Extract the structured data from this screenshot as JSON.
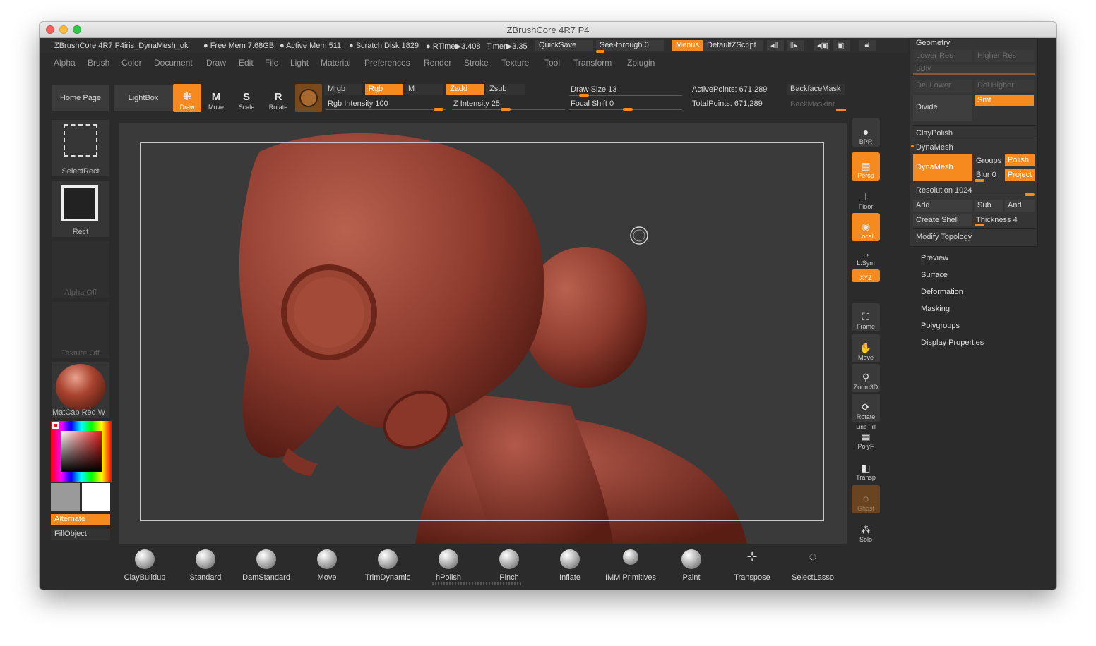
{
  "window": {
    "title": "ZBrushCore 4R7 P4"
  },
  "status": {
    "doc": "ZBrushCore 4R7 P4iris_DynaMesh_ok",
    "free_mem": "● Free Mem 7.68GB",
    "active_mem": "● Active Mem 511",
    "scratch": "● Scratch Disk 1829",
    "rtime": "● RTime▶3.408",
    "timer": "Timer▶3.35",
    "quicksave": "QuickSave",
    "see_through": "See-through  0",
    "menus": "Menus",
    "zscript": "DefaultZScript"
  },
  "menu": [
    "Alpha",
    "Brush",
    "Color",
    "Document",
    "Draw",
    "Edit",
    "File",
    "Light",
    "Material",
    "Preferences",
    "Render",
    "Stroke",
    "Texture",
    "Tool",
    "Transform",
    "Zplugin"
  ],
  "shelf": {
    "home": "Home Page",
    "lightbox": "LightBox",
    "draw": "Draw",
    "move": "Move",
    "scale": "Scale",
    "rotate": "Rotate",
    "mrgb": "Mrgb",
    "rgb": "Rgb",
    "m": "M",
    "zadd": "Zadd",
    "zsub": "Zsub",
    "rgb_intensity": "Rgb Intensity 100",
    "z_intensity": "Z Intensity 25",
    "draw_size": "Draw Size 13",
    "focal_shift": "Focal Shift 0",
    "active_points": "ActivePoints: 671,289",
    "total_points": "TotalPoints: 671,289",
    "backface": "BackfaceMask",
    "backmask": "BackMaskInt"
  },
  "left": {
    "select_rect": "SelectRect",
    "rect": "Rect",
    "alpha": "Alpha Off",
    "texture": "Texture Off",
    "matcap": "MatCap Red W",
    "alternate": "Alternate",
    "fill": "FillObject"
  },
  "right": {
    "bpr": "BPR",
    "persp": "Persp",
    "floor": "Floor",
    "local": "Local",
    "lsym": "L.Sym",
    "xyz": "XYZ",
    "frame": "Frame",
    "move": "Move",
    "zoom": "Zoom3D",
    "rotate": "Rotate",
    "polyf": "PolyF",
    "line_fill": "Line Fill",
    "transp": "Transp",
    "ghost": "Ghost",
    "solo": "Solo"
  },
  "tray": {
    "geometry": "Geometry",
    "lower_res": "Lower Res",
    "higher_res": "Higher Res",
    "sdiv": "SDiv",
    "del_lower": "Del Lower",
    "del_higher": "Del Higher",
    "divide": "Divide",
    "smt": "Smt",
    "claypolish": "ClayPolish",
    "dynamesh_h": "DynaMesh",
    "dynamesh_btn": "DynaMesh",
    "groups": "Groups",
    "polish": "Polish",
    "blur": "Blur 0",
    "project": "Project",
    "resolution": "Resolution 1024",
    "add": "Add",
    "sub": "Sub",
    "and": "And",
    "create_shell": "Create Shell",
    "thickness": "Thickness 4",
    "modify_topology": "Modify Topology"
  },
  "tool_sections": [
    "Preview",
    "Surface",
    "Deformation",
    "Masking",
    "Polygroups",
    "Display Properties"
  ],
  "brushes": [
    "ClayBuildup",
    "Standard",
    "DamStandard",
    "Move",
    "TrimDynamic",
    "hPolish",
    "Pinch",
    "Inflate",
    "IMM Primitives",
    "Paint",
    "Transpose",
    "SelectLasso"
  ],
  "imm_count": "3",
  "colors": {
    "accent": "#f68a1e",
    "clay": "#8e3b2e"
  }
}
